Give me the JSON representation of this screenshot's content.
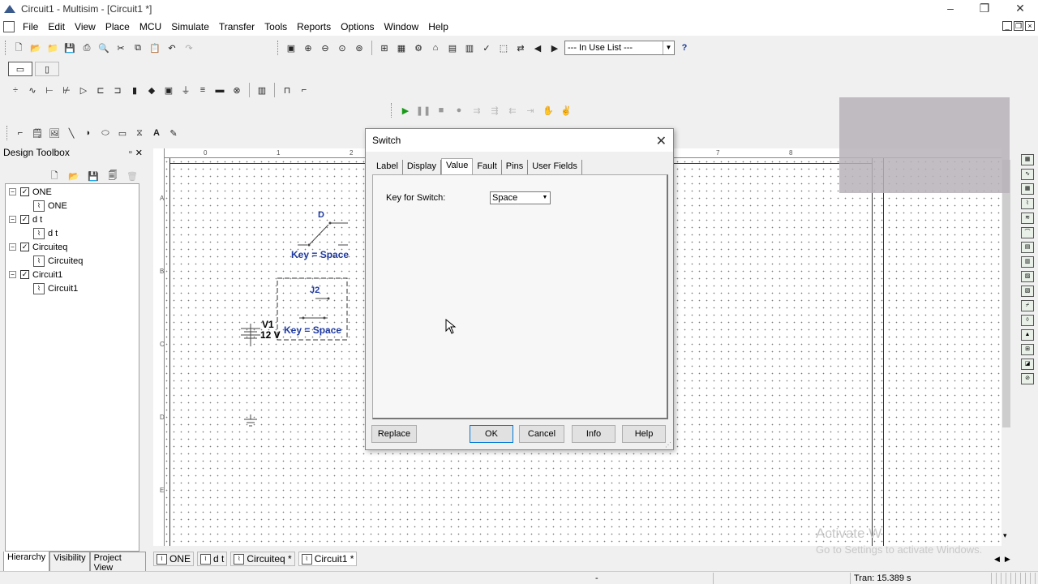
{
  "window": {
    "title": "Circuit1 - Multisim - [Circuit1 *]",
    "controls": {
      "minimize": "–",
      "restore": "❐",
      "close": "✕"
    }
  },
  "menu": [
    "File",
    "Edit",
    "View",
    "Place",
    "MCU",
    "Simulate",
    "Transfer",
    "Tools",
    "Reports",
    "Options",
    "Window",
    "Help"
  ],
  "toolbar": {
    "in_use_list": "--- In Use List ---",
    "help_glyph": "?"
  },
  "design_toolbox": {
    "title": "Design Toolbox",
    "tree": [
      {
        "label": "ONE",
        "child": "ONE"
      },
      {
        "label": "d t",
        "child": "d t"
      },
      {
        "label": "Circuiteq",
        "child": "Circuiteq"
      },
      {
        "label": "Circuit1",
        "child": "Circuit1"
      }
    ],
    "tabs": [
      "Hierarchy",
      "Visibility",
      "Project View"
    ]
  },
  "canvas": {
    "ruler_top": [
      "0",
      "1",
      "2",
      "7",
      "8"
    ],
    "ruler_left": [
      "A",
      "B",
      "C",
      "D",
      "E"
    ],
    "switch_d": {
      "ref": "D",
      "key": "Key = Space"
    },
    "switch_j2": {
      "ref": "J2",
      "key": "Key = Space"
    },
    "battery": {
      "ref": "V1",
      "value": "12 V"
    }
  },
  "dialog": {
    "title": "Switch",
    "tabs": [
      "Label",
      "Display",
      "Value",
      "Fault",
      "Pins",
      "User Fields"
    ],
    "active_tab": "Value",
    "field_label": "Key for Switch:",
    "field_value": "Space",
    "buttons": {
      "replace": "Replace",
      "ok": "OK",
      "cancel": "Cancel",
      "info": "Info",
      "help": "Help"
    }
  },
  "doc_tabs": [
    "ONE",
    "d t",
    "Circuiteq *",
    "Circuit1 *"
  ],
  "status": {
    "dash": "-",
    "tran": "Tran: 15.389 s"
  },
  "watermark": {
    "line1": "Activate W",
    "line2": "Go to Settings to activate Windows."
  },
  "colors": {
    "schematic_text": "#1f3aa0",
    "accent": "#0078d7"
  }
}
